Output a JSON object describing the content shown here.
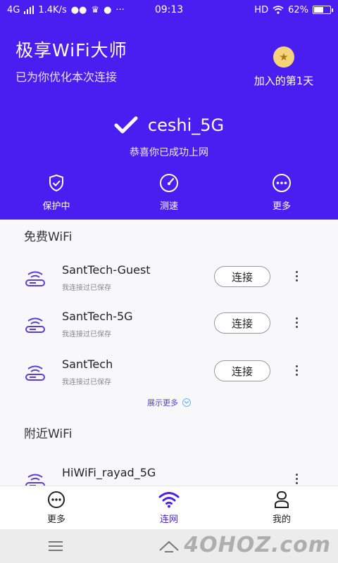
{
  "status_bar": {
    "network": "4G",
    "speed": "1.4K/s",
    "dots": "···",
    "time": "09:13",
    "hd": "HD",
    "battery": "62%",
    "battery_level": 0.62
  },
  "header": {
    "title": "极享WiFi大师",
    "subtitle": "已为你优化本次连接",
    "days": "加入的第1天",
    "ssid": "ceshi_5G",
    "success": "恭喜你已成功上网",
    "actions": [
      {
        "label": "保护中",
        "icon": "shield-check-icon"
      },
      {
        "label": "测速",
        "icon": "speedometer-icon"
      },
      {
        "label": "更多",
        "icon": "more-circle-icon"
      }
    ]
  },
  "free_wifi": {
    "title": "免费WiFi",
    "items": [
      {
        "name": "SantTech-Guest",
        "sub": "我连接过已保存",
        "button": "连接"
      },
      {
        "name": "SantTech-5G",
        "sub": "我连接过已保存",
        "button": "连接"
      },
      {
        "name": "SantTech",
        "sub": "我连接过已保存",
        "button": "连接"
      }
    ],
    "show_more": "展示更多"
  },
  "nearby_wifi": {
    "title": "附近WiFi",
    "items": [
      {
        "name": "HiWiFi_rayad_5G"
      }
    ]
  },
  "bottom_nav": [
    {
      "label": "更多",
      "icon": "chat-dots-icon",
      "active": false
    },
    {
      "label": "连网",
      "icon": "wifi-icon",
      "active": true
    },
    {
      "label": "我的",
      "icon": "user-icon",
      "active": false
    }
  ],
  "watermark": "4OHOZ.com",
  "colors": {
    "brand": "#4a1ef0",
    "accent_purple": "#5b3ddb",
    "background": "#f8f8fa"
  }
}
